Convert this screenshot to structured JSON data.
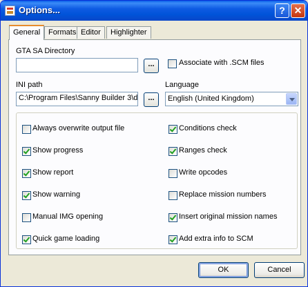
{
  "window": {
    "title": "Options..."
  },
  "tabs": [
    {
      "label": "General"
    },
    {
      "label": "Formats"
    },
    {
      "label": "Editor"
    },
    {
      "label": "Highlighter"
    }
  ],
  "general": {
    "gta_dir_label": "GTA SA Directory",
    "gta_dir_value": "",
    "browse_label": "...",
    "associate_label": "Associate with .SCM files",
    "associate_checked": false,
    "ini_label": "INI path",
    "ini_value": "C:\\Program Files\\Sanny Builder 3\\d",
    "language_label": "Language",
    "language_value": "English (United Kingdom)"
  },
  "options_left": [
    {
      "label": "Always overwrite output file",
      "checked": false
    },
    {
      "label": "Show progress",
      "checked": true
    },
    {
      "label": "Show report",
      "checked": true
    },
    {
      "label": "Show warning",
      "checked": true
    },
    {
      "label": "Manual IMG opening",
      "checked": false
    },
    {
      "label": "Quick game loading",
      "checked": true
    }
  ],
  "options_right": [
    {
      "label": "Conditions check",
      "checked": true
    },
    {
      "label": "Ranges check",
      "checked": true
    },
    {
      "label": "Write opcodes",
      "checked": false
    },
    {
      "label": "Replace mission numbers",
      "checked": false
    },
    {
      "label": "Insert original mission names",
      "checked": true
    },
    {
      "label": "Add extra info to SCM",
      "checked": true
    }
  ],
  "buttons": {
    "ok": "OK",
    "cancel": "Cancel"
  }
}
